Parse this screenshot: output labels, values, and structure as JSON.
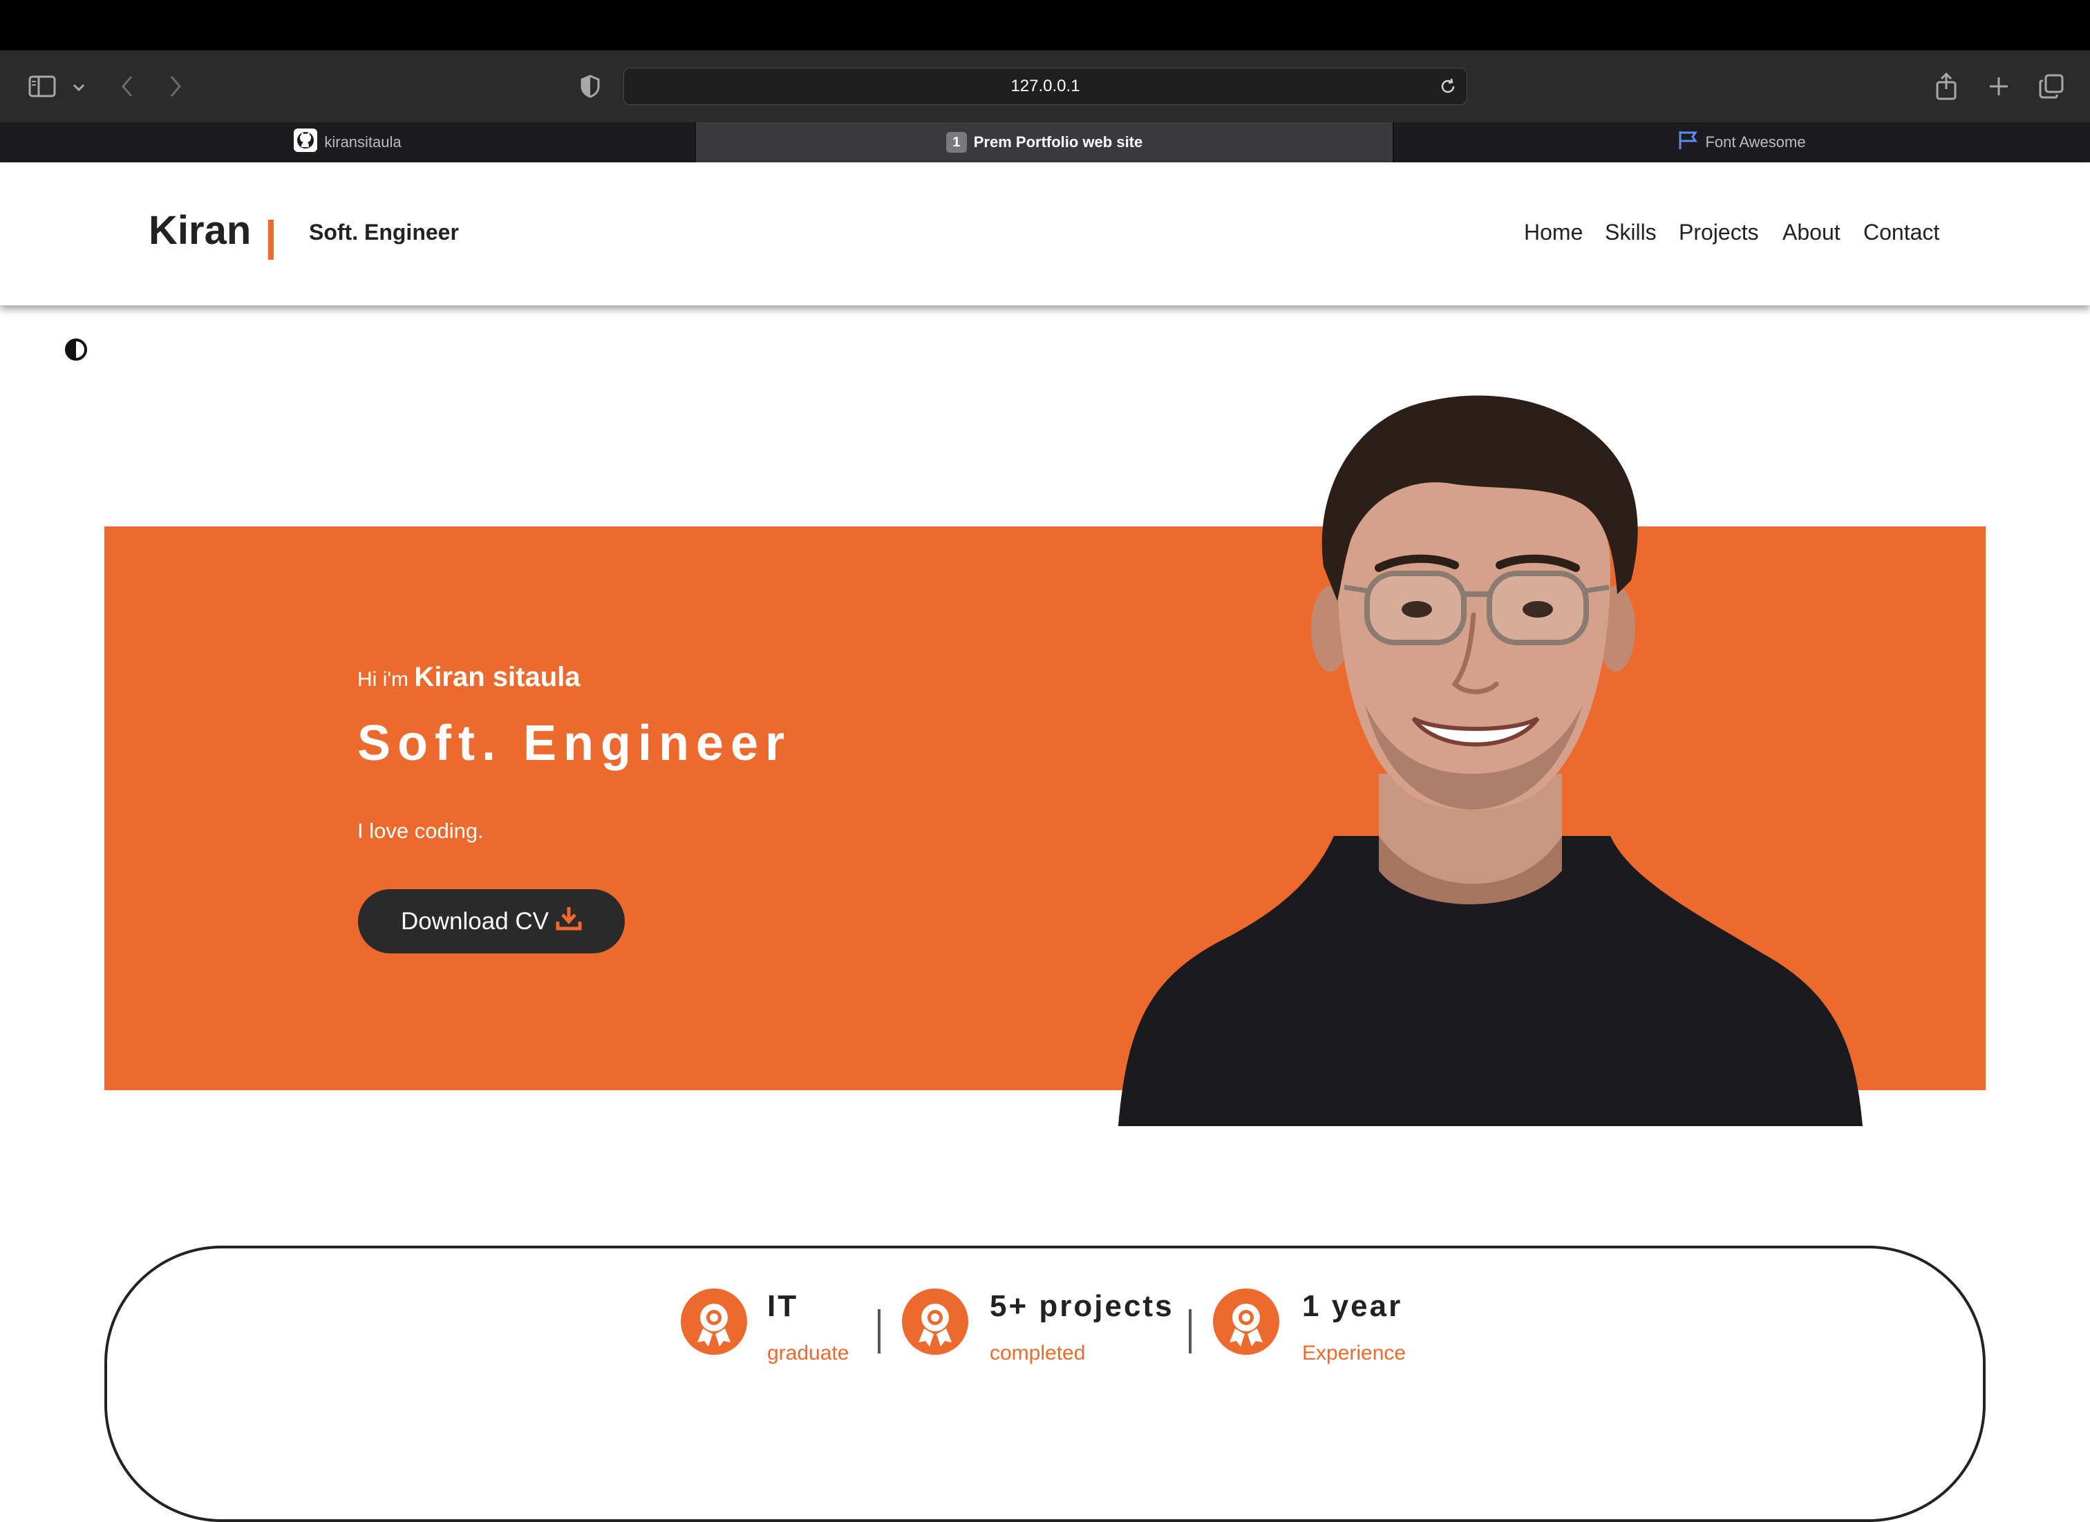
{
  "browser": {
    "url": "127.0.0.1",
    "tabs": [
      {
        "label": "kiransitaula",
        "icon": "github-icon",
        "active": false
      },
      {
        "label": "Prem Portfolio web site",
        "badge": "1",
        "active": true
      },
      {
        "label": "Font Awesome",
        "icon": "flag-icon",
        "active": false
      }
    ]
  },
  "header": {
    "brand": "Kiran",
    "role": "Soft. Engineer",
    "nav": [
      "Home",
      "Skills",
      "Projects",
      "About",
      "Contact"
    ]
  },
  "hero": {
    "greeting": "Hi i'm",
    "name": "Kiran sitaula",
    "title": "Soft. Engineer",
    "tagline": "I love coding.",
    "cv_label": "Download CV"
  },
  "stats": [
    {
      "title": "IT",
      "sub": "graduate"
    },
    {
      "title": "5+ projects",
      "sub": "completed"
    },
    {
      "title": "1 year",
      "sub": "Experience"
    }
  ],
  "colors": {
    "accent": "#ec6a2d",
    "dark": "#2a2a2a"
  }
}
